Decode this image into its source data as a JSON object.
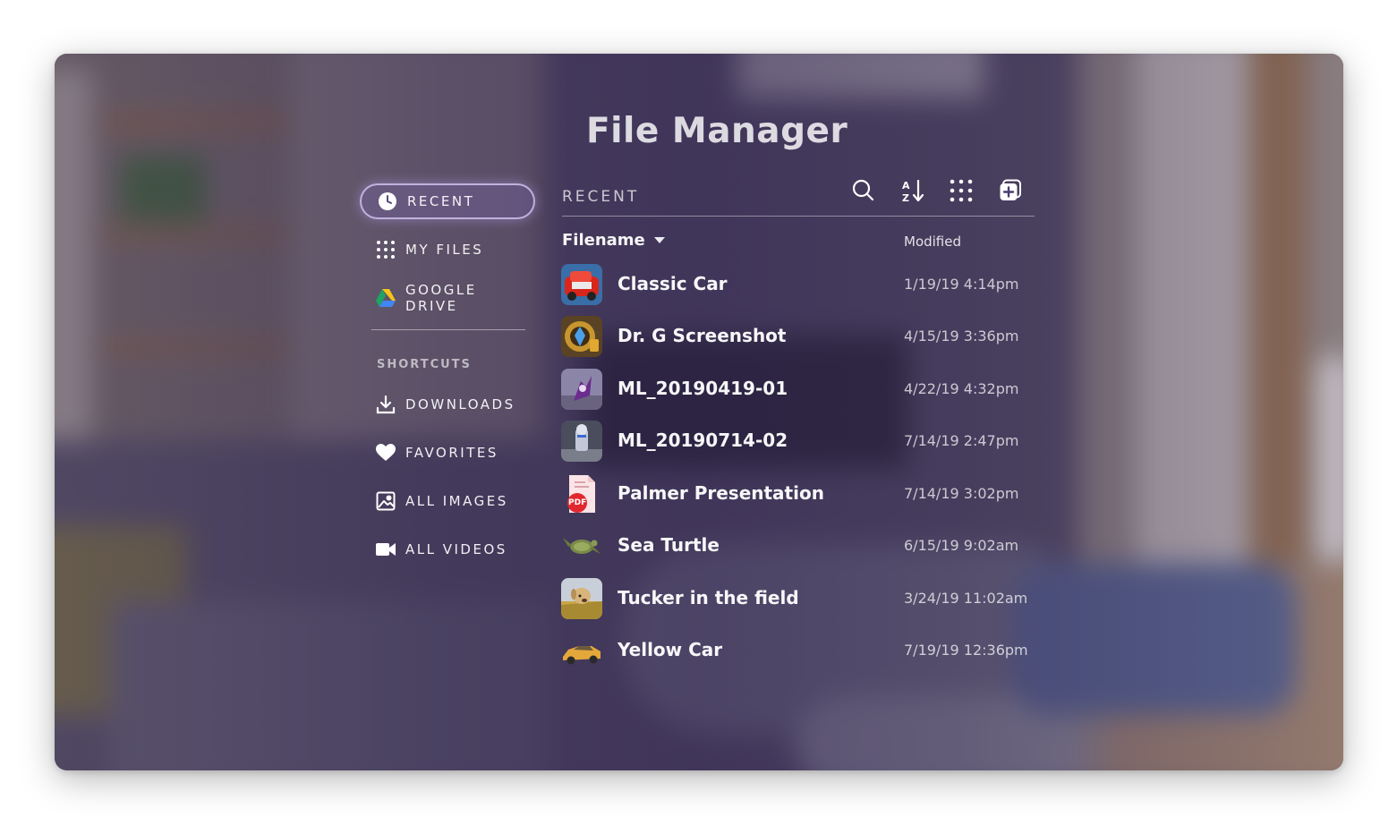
{
  "app": {
    "title": "File Manager"
  },
  "nav": {
    "items": [
      {
        "label": "RECENT",
        "icon": "clock-icon",
        "active": true
      },
      {
        "label": "MY FILES",
        "icon": "grid-dots-icon"
      },
      {
        "label": "GOOGLE DRIVE",
        "icon": "google-drive-icon"
      }
    ],
    "shortcuts_label": "SHORTCUTS",
    "shortcuts": [
      {
        "label": "DOWNLOADS",
        "icon": "download-icon"
      },
      {
        "label": "FAVORITES",
        "icon": "heart-icon"
      },
      {
        "label": "ALL IMAGES",
        "icon": "image-icon"
      },
      {
        "label": "ALL VIDEOS",
        "icon": "video-camera-icon"
      }
    ]
  },
  "main": {
    "section_label": "RECENT",
    "toolbar": [
      "search-icon",
      "sort-alpha-icon",
      "grid-view-icon",
      "add-window-icon"
    ],
    "columns": {
      "filename": "Filename",
      "modified": "Modified"
    },
    "files": [
      {
        "name": "Classic Car",
        "modified": "1/19/19 4:14pm",
        "thumb": "classic-car-thumbnail"
      },
      {
        "name": "Dr. G Screenshot",
        "modified": "4/15/19 3:36pm",
        "thumb": "screenshot-thumbnail"
      },
      {
        "name": "ML_20190419-01",
        "modified": "4/22/19 4:32pm",
        "thumb": "ml-capture-thumbnail"
      },
      {
        "name": "ML_20190714-02",
        "modified": "7/14/19 2:47pm",
        "thumb": "ml-capture-thumbnail"
      },
      {
        "name": "Palmer Presentation",
        "modified": "7/14/19 3:02pm",
        "thumb": "pdf-icon"
      },
      {
        "name": "Sea Turtle",
        "modified": "6/15/19 9:02am",
        "thumb": "sea-turtle-thumbnail"
      },
      {
        "name": "Tucker in the field",
        "modified": "3/24/19 11:02am",
        "thumb": "dog-photo-thumbnail"
      },
      {
        "name": "Yellow Car",
        "modified": "7/19/19 12:36pm",
        "thumb": "yellow-car-thumbnail"
      }
    ],
    "pdf_badge": "PDF"
  },
  "colors": {
    "accent_glow": "#c9bcff",
    "tint": "#2d2150"
  }
}
